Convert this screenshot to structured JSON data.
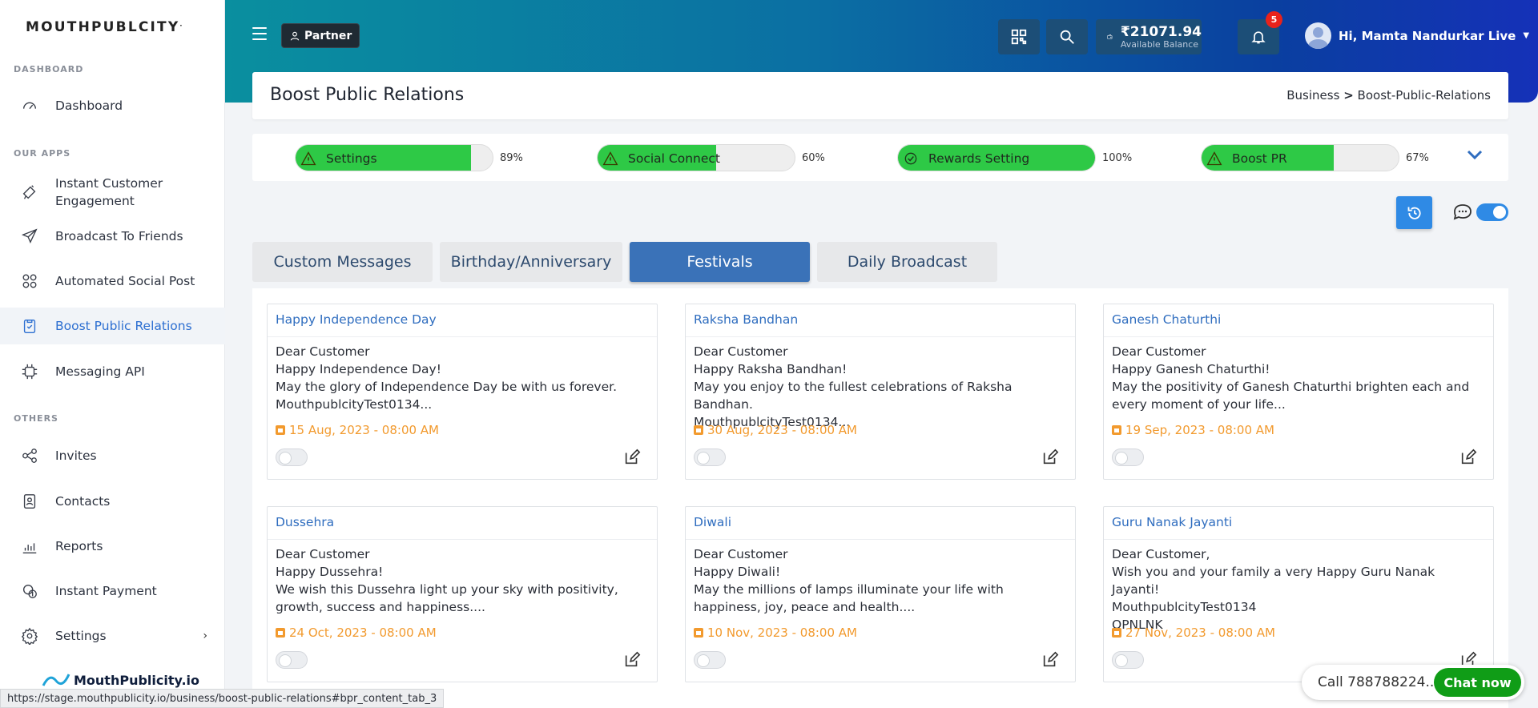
{
  "brand": {
    "name": "MOUTHPUBLCITY",
    "mark": "."
  },
  "sidebar": {
    "sections": {
      "dashboard": "DASHBOARD",
      "apps": "OUR APPS",
      "others": "OTHERS"
    },
    "items": [
      {
        "label": "Dashboard",
        "icon": "speedometer-icon"
      },
      {
        "label": "Instant Customer Engagement",
        "icon": "megaphone-icon"
      },
      {
        "label": "Broadcast To Friends",
        "icon": "paper-plane-icon"
      },
      {
        "label": "Automated Social Post",
        "icon": "apps-grid-icon"
      },
      {
        "label": "Boost Public Relations",
        "icon": "clipboard-icon"
      },
      {
        "label": "Messaging API",
        "icon": "api-chip-icon"
      },
      {
        "label": "Invites",
        "icon": "share-icon"
      },
      {
        "label": "Contacts",
        "icon": "contact-card-icon"
      },
      {
        "label": "Reports",
        "icon": "bar-chart-icon"
      },
      {
        "label": "Instant Payment",
        "icon": "payment-icon"
      },
      {
        "label": "Settings",
        "icon": "gear-icon"
      }
    ],
    "footer_brand": "MouthPublicity.io"
  },
  "header": {
    "partner_label": "Partner",
    "balance_amount": "₹21071.94",
    "balance_label": "Available Balance",
    "notification_count": "5",
    "user_greeting": "Hi, Mamta Nandurkar Live"
  },
  "page": {
    "title": "Boost Public Relations",
    "breadcrumb_root": "Business",
    "breadcrumb_sep": ">",
    "breadcrumb_current": "Boost-Public-Relations"
  },
  "progress": [
    {
      "label": "Settings",
      "percent": 89,
      "percent_text": "89%",
      "status": "warning"
    },
    {
      "label": "Social Connect",
      "percent": 60,
      "percent_text": "60%",
      "status": "warning"
    },
    {
      "label": "Rewards Setting",
      "percent": 100,
      "percent_text": "100%",
      "status": "complete"
    },
    {
      "label": "Boost PR",
      "percent": 67,
      "percent_text": "67%",
      "status": "warning"
    }
  ],
  "tabs": [
    {
      "label": "Custom Messages",
      "active": false
    },
    {
      "label": "Birthday/Anniversary",
      "active": false
    },
    {
      "label": "Festivals",
      "active": true
    },
    {
      "label": "Daily Broadcast",
      "active": false
    }
  ],
  "cards": [
    {
      "title": "Happy Independence Day",
      "lines": [
        "Dear Customer",
        "Happy Independence Day!",
        "May the glory of Independence Day be with us forever.",
        "MouthpublcityTest0134..."
      ],
      "date": "15 Aug, 2023 - 08:00 AM",
      "enabled": false
    },
    {
      "title": "Raksha Bandhan",
      "lines": [
        "Dear Customer",
        "Happy Raksha Bandhan!",
        "May you enjoy to the fullest celebrations of Raksha Bandhan.",
        "MouthpublcityTest0134..."
      ],
      "date": "30 Aug, 2023 - 08:00 AM",
      "enabled": false
    },
    {
      "title": "Ganesh Chaturthi",
      "lines": [
        "Dear Customer",
        "Happy Ganesh Chaturthi!",
        "May the positivity of Ganesh Chaturthi brighten each and every moment of your life..."
      ],
      "date": "19 Sep, 2023 - 08:00 AM",
      "enabled": false
    },
    {
      "title": "Dussehra",
      "lines": [
        "Dear Customer",
        "Happy Dussehra!",
        "We wish this Dussehra light up your sky with positivity, growth, success and happiness...."
      ],
      "date": "24 Oct, 2023 - 08:00 AM",
      "enabled": false
    },
    {
      "title": "Diwali",
      "lines": [
        "Dear Customer",
        "Happy Diwali!",
        "May the millions of lamps illuminate your life with happiness, joy, peace and health...."
      ],
      "date": "10 Nov, 2023 - 08:00 AM",
      "enabled": false
    },
    {
      "title": "Guru Nanak Jayanti",
      "lines": [
        "Dear Customer,",
        "Wish you and your family a very Happy Guru Nanak Jayanti!",
        "MouthpublcityTest0134",
        "OPNLNK"
      ],
      "date": "27 Nov, 2023 - 08:00 AM",
      "enabled": false
    }
  ],
  "status_url": "https://stage.mouthpublicity.io/business/boost-public-relations#bpr_content_tab_3",
  "call": {
    "text": "Call 788788224...",
    "button": "Chat now"
  },
  "colors": {
    "accent": "#2f8ae5",
    "progress_green": "#2ec946",
    "date_orange": "#f29a2e",
    "tab_active": "#3a72b8",
    "chat_green": "#109d17"
  }
}
